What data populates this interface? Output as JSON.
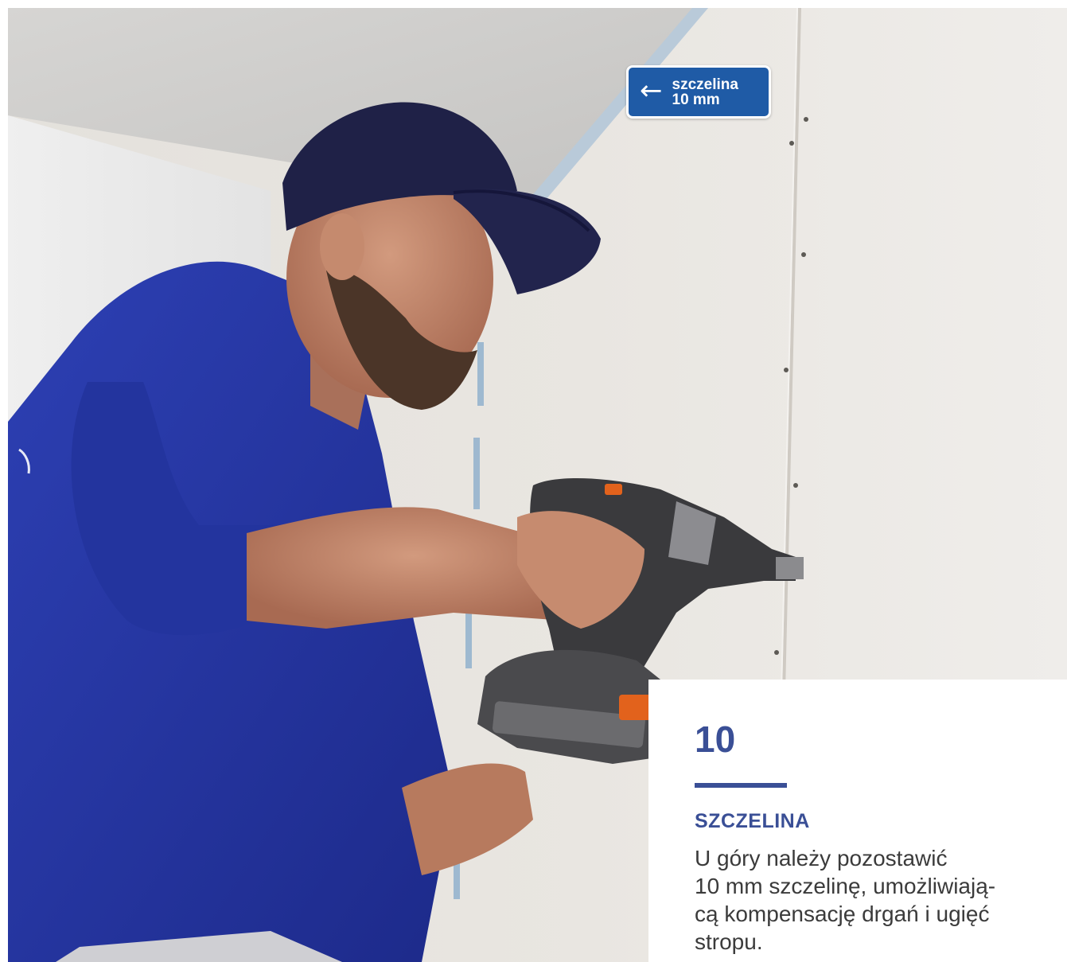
{
  "callout": {
    "arrow_icon": "left-arrow-icon",
    "line1": "szczelina",
    "line2": "10 mm",
    "background_color": "#1f5ba6"
  },
  "step": {
    "number": "10",
    "heading": "SZCZELINA",
    "body_lines": [
      "U góry należy pozostawić",
      "10 mm szczelinę, umożliwiają-",
      "cą kompensację drgań i ugięć",
      "stropu."
    ],
    "accent_color": "#3a4f96"
  },
  "photo": {
    "alt": "Worker in blue cap and shirt screwing drywall board to the wall with a cordless screwdriver"
  }
}
